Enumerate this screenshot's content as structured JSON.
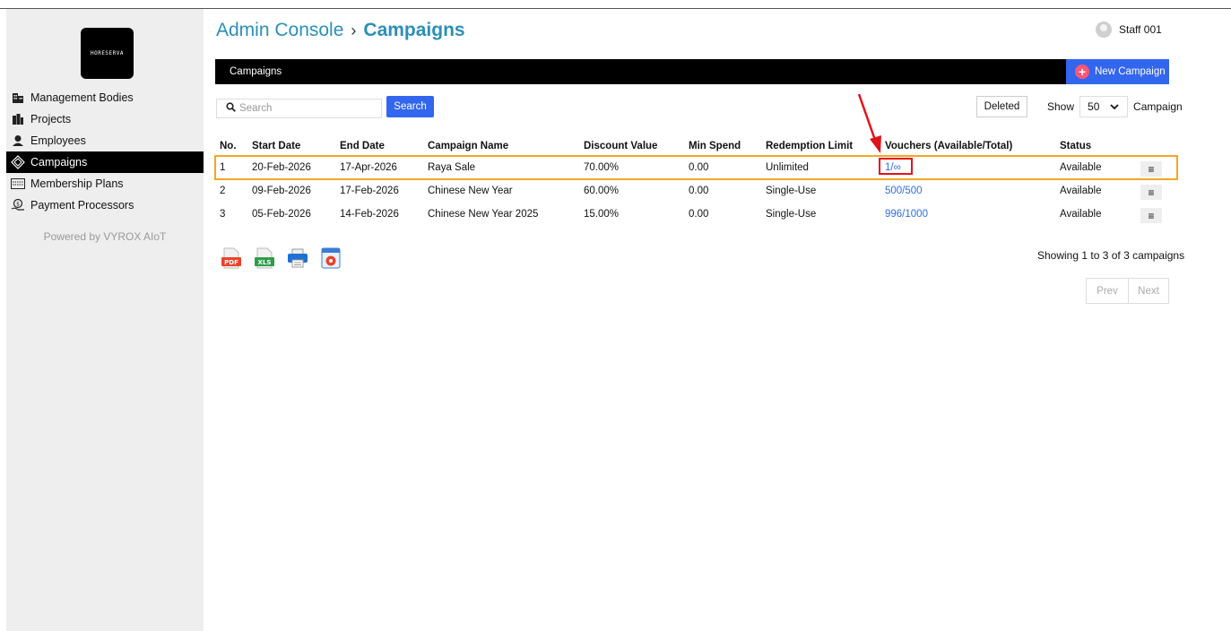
{
  "app": {
    "logo_text": "HORESERVA",
    "breadcrumb_root": "Admin Console",
    "breadcrumb_sep": "›",
    "breadcrumb_current": "Campaigns"
  },
  "user": {
    "name": "Staff 001"
  },
  "sidebar": {
    "items": [
      {
        "label": "Management Bodies",
        "icon": "building-icon",
        "active": false
      },
      {
        "label": "Projects",
        "icon": "projects-icon",
        "active": false
      },
      {
        "label": "Employees",
        "icon": "employee-icon",
        "active": false
      },
      {
        "label": "Campaigns",
        "icon": "tag-icon",
        "active": true
      },
      {
        "label": "Membership Plans",
        "icon": "card-icon",
        "active": false
      },
      {
        "label": "Payment Processors",
        "icon": "payment-icon",
        "active": false
      }
    ],
    "powered_by": "Powered by VYROX AIoT"
  },
  "header_bar": {
    "title": "Campaigns",
    "new_button": "New Campaign"
  },
  "toolbar": {
    "search_placeholder": "Search",
    "search_button": "Search",
    "deleted_button": "Deleted",
    "show_label": "Show",
    "page_size": "50",
    "per_page_suffix": "Campaign"
  },
  "table": {
    "headers": [
      "No.",
      "Start Date",
      "End Date",
      "Campaign Name",
      "Discount Value",
      "Min Spend",
      "Redemption Limit",
      "Vouchers (Available/Total)",
      "Status"
    ],
    "rows": [
      {
        "no": "1",
        "start": "20-Feb-2026",
        "end": "17-Apr-2026",
        "name": "Raya Sale",
        "discount": "70.00%",
        "min_spend": "0.00",
        "limit": "Unlimited",
        "vouchers": "1/∞",
        "status": "Available"
      },
      {
        "no": "2",
        "start": "09-Feb-2026",
        "end": "17-Feb-2026",
        "name": "Chinese New Year",
        "discount": "60.00%",
        "min_spend": "0.00",
        "limit": "Single-Use",
        "vouchers": "500/500",
        "status": "Available"
      },
      {
        "no": "3",
        "start": "05-Feb-2026",
        "end": "14-Feb-2026",
        "name": "Chinese New Year 2025",
        "discount": "15.00%",
        "min_spend": "0.00",
        "limit": "Single-Use",
        "vouchers": "996/1000",
        "status": "Available"
      }
    ],
    "row_menu_glyph": "≡"
  },
  "export": {
    "pdf_label": "PDF",
    "xls_label": "XLS"
  },
  "footer": {
    "showing": "Showing 1 to 3 of 3 campaigns",
    "prev": "Prev",
    "next": "Next"
  },
  "colors": {
    "accent_blue": "#3366ee",
    "title_teal": "#2a8fb8",
    "highlight_orange": "#f5a623",
    "highlight_red": "#e0131b"
  }
}
